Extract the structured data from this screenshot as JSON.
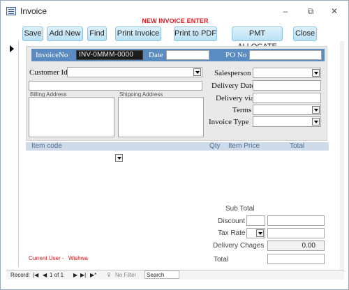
{
  "window": {
    "title": "Invoice",
    "controls": {
      "minimize": "–",
      "restore": "⧉",
      "close": "✕"
    }
  },
  "banner": {
    "text": "NEW INVOICE ENTER"
  },
  "toolbar": {
    "save": "Save",
    "add_new": "Add New",
    "find": "Find",
    "print_invoice": "Print Invoice",
    "print_pdf": "Print to PDF",
    "pmt_allocate": "PMT ALLOCATE",
    "close": "Close"
  },
  "header": {
    "invoice_no_label": "InvoiceNo",
    "invoice_no_value": "INV-0MMM-0000",
    "date_label": "Date",
    "date_value": "",
    "po_label": "PO No",
    "po_value": ""
  },
  "customer": {
    "label": "Customer Id",
    "value": "",
    "name_value": "",
    "billing_label": "Billing Address",
    "billing_value": "",
    "shipping_label": "Shipping Address",
    "shipping_value": ""
  },
  "right_fields": {
    "salesperson_label": "Salesperson",
    "salesperson_value": "",
    "delivery_date_label": "Delivery Date",
    "delivery_date_value": "",
    "delivery_via_label": "Delivery via",
    "delivery_via_value": "",
    "terms_label": "Terms",
    "terms_value": "",
    "invoice_type_label": "Invoice Type",
    "invoice_type_value": ""
  },
  "items_grid": {
    "columns": [
      "Item code",
      "Qty",
      "Item Price",
      "Total"
    ],
    "rows": []
  },
  "totals": {
    "subtotal_label": "Sub Total",
    "discount_label": "Discount",
    "discount_value": "",
    "tax_rate_label": "Tax Rate",
    "tax_rate_value": "",
    "delivery_charges_label": "Delivery Chages",
    "delivery_charges_value": "0.00",
    "total_label": "Total",
    "total_value": ""
  },
  "current_user": {
    "label": "Current User -",
    "name": "Wishwa"
  },
  "navigation": {
    "record_label": "Record:",
    "position": "1 of 1",
    "filter_label": "No Filter",
    "search_label": "Search"
  },
  "colors": {
    "header_strip": "#5a8bc1",
    "banner_red": "#e0171d",
    "button_fill": "#c9e9f8"
  }
}
